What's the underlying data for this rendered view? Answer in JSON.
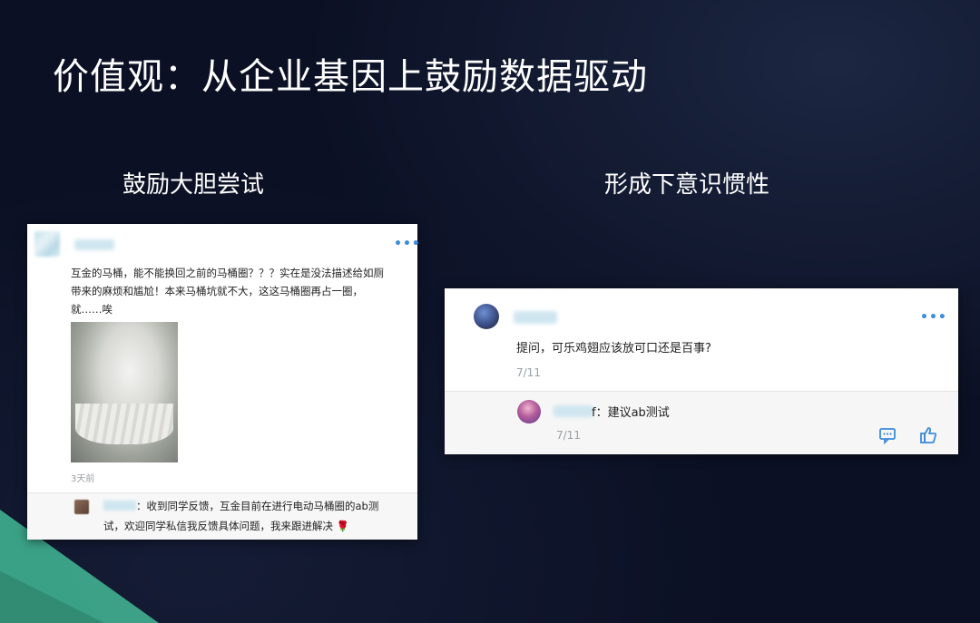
{
  "slide": {
    "title": "价值观：从企业基因上鼓励数据驱动",
    "left_heading": "鼓励大胆尝试",
    "right_heading": "形成下意识惯性"
  },
  "left_card": {
    "more_label": "•••",
    "post_text_line1": "互金的马桶，能不能换回之前的马桶圈？？？实在是没法描述给如厕",
    "post_text_line2": "带来的麻烦和尴尬！本来马桶坑就不大，这这马桶圈再占一圈，",
    "post_text_line3": "就……唉",
    "time": "3天前",
    "reply_line1": "：收到同学反馈，互金目前在进行电动马桶圈的ab测",
    "reply_line2": "试，欢迎同学私信我反馈具体问题，我来跟进解决",
    "reply_emoji": "🌹"
  },
  "right_card": {
    "more_label": "•••",
    "question": "提问，可乐鸡翅应该放可口还是百事?",
    "date": "7/11",
    "reply_suffix": "f：建议ab测试",
    "reply_date": "7/11"
  },
  "colors": {
    "background": "#0b1024",
    "accent_green": "#3ea98b",
    "link_blue": "#3d8bdb"
  }
}
